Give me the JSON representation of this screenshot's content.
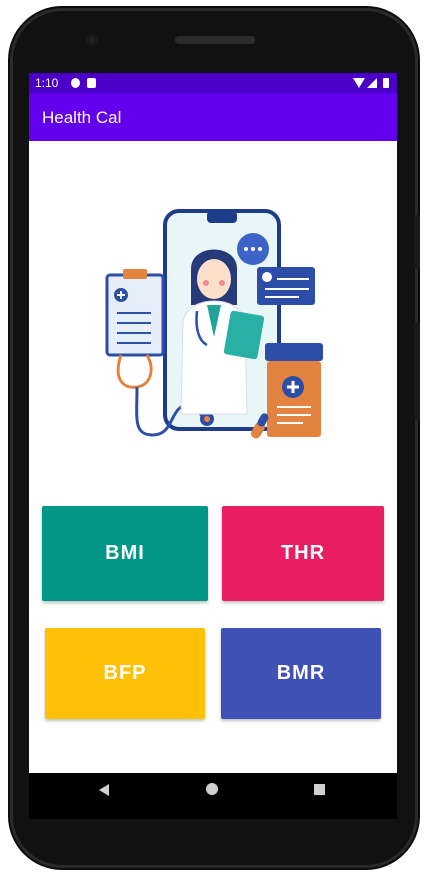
{
  "status": {
    "time": "1:10"
  },
  "appbar": {
    "title": "Health Cal"
  },
  "buttons": [
    {
      "label": "BMI",
      "color": "#009688"
    },
    {
      "label": "THR",
      "color": "#e91e63"
    },
    {
      "label": "BFP",
      "color": "#ffc107"
    },
    {
      "label": "BMR",
      "color": "#3f51b5"
    }
  ],
  "colors": {
    "statusbar": "#4a00c8",
    "appbar": "#6200ee"
  },
  "illustration": {
    "icon": "doctor-phone-illustration"
  }
}
